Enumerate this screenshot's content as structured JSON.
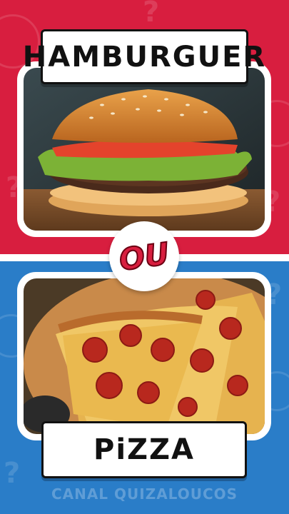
{
  "options": {
    "top": {
      "label": "HAMBURGUER",
      "image": "hamburger-photo"
    },
    "bottom": {
      "label": "PiZZA",
      "image": "pizza-photo"
    }
  },
  "separator": "OU",
  "watermark": "CANAL QUIZALOUCOS",
  "colors": {
    "top_bg": "#d81e3f",
    "bottom_bg": "#2a7dc8",
    "card": "#ffffff",
    "label_text": "#111111"
  }
}
